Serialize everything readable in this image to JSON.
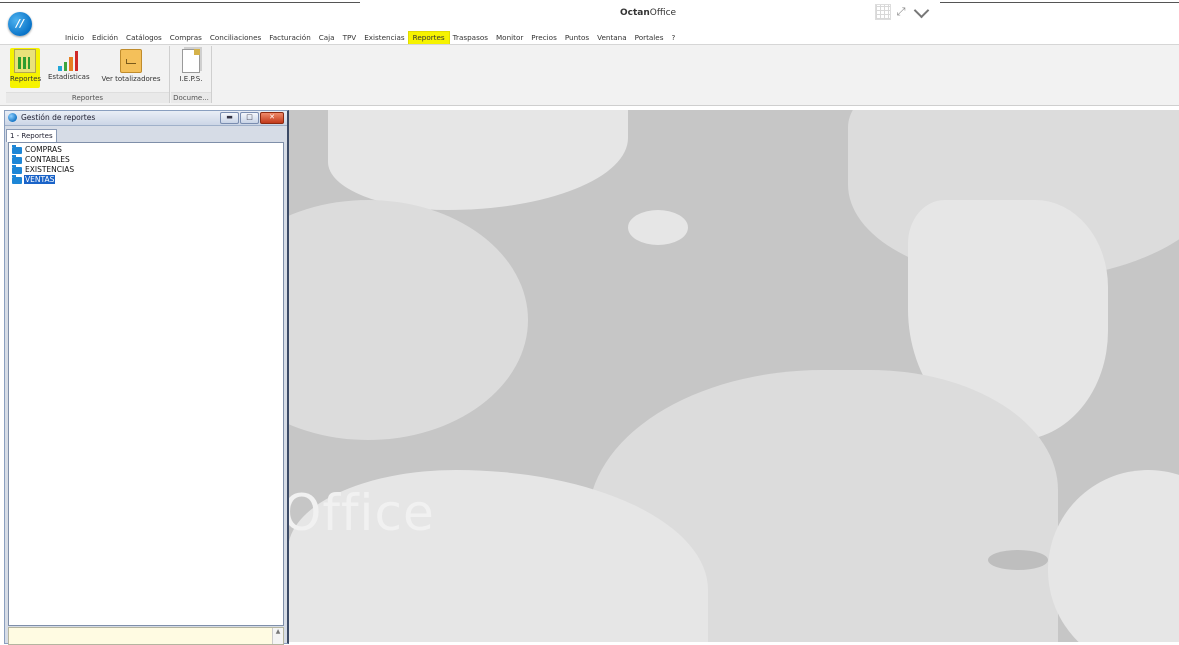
{
  "window": {
    "title_bold": "Octan",
    "title_rest": "Office",
    "orb_label": "//"
  },
  "menu": [
    {
      "label": "Inicio"
    },
    {
      "label": "Edición"
    },
    {
      "label": "Catálogos"
    },
    {
      "label": "Compras"
    },
    {
      "label": "Conciliaciones"
    },
    {
      "label": "Facturación"
    },
    {
      "label": "Caja"
    },
    {
      "label": "TPV"
    },
    {
      "label": "Existencias"
    },
    {
      "label": "Reportes",
      "active": true
    },
    {
      "label": "Traspasos"
    },
    {
      "label": "Monitor"
    },
    {
      "label": "Precios"
    },
    {
      "label": "Puntos"
    },
    {
      "label": "Ventana"
    },
    {
      "label": "Portales"
    },
    {
      "label": "?"
    }
  ],
  "ribbon": {
    "groups": [
      {
        "label": "Reportes",
        "buttons": [
          "Reportes",
          "Estadísticas",
          "Ver totalizadores"
        ]
      },
      {
        "label": "Docume...",
        "buttons": [
          "I.E.P.S."
        ]
      }
    ]
  },
  "child_window": {
    "title": "Gestión de reportes",
    "tab": "1 - Reportes",
    "tree": [
      {
        "label": "COMPRAS"
      },
      {
        "label": "CONTABLES"
      },
      {
        "label": "EXISTENCIAS"
      },
      {
        "label": "VENTAS",
        "selected": true
      }
    ]
  },
  "workspace": {
    "watermark": "Office"
  },
  "colors": {
    "highlight": "#f6f300",
    "selection": "#1a63c8",
    "folder": "#1d86d6"
  }
}
